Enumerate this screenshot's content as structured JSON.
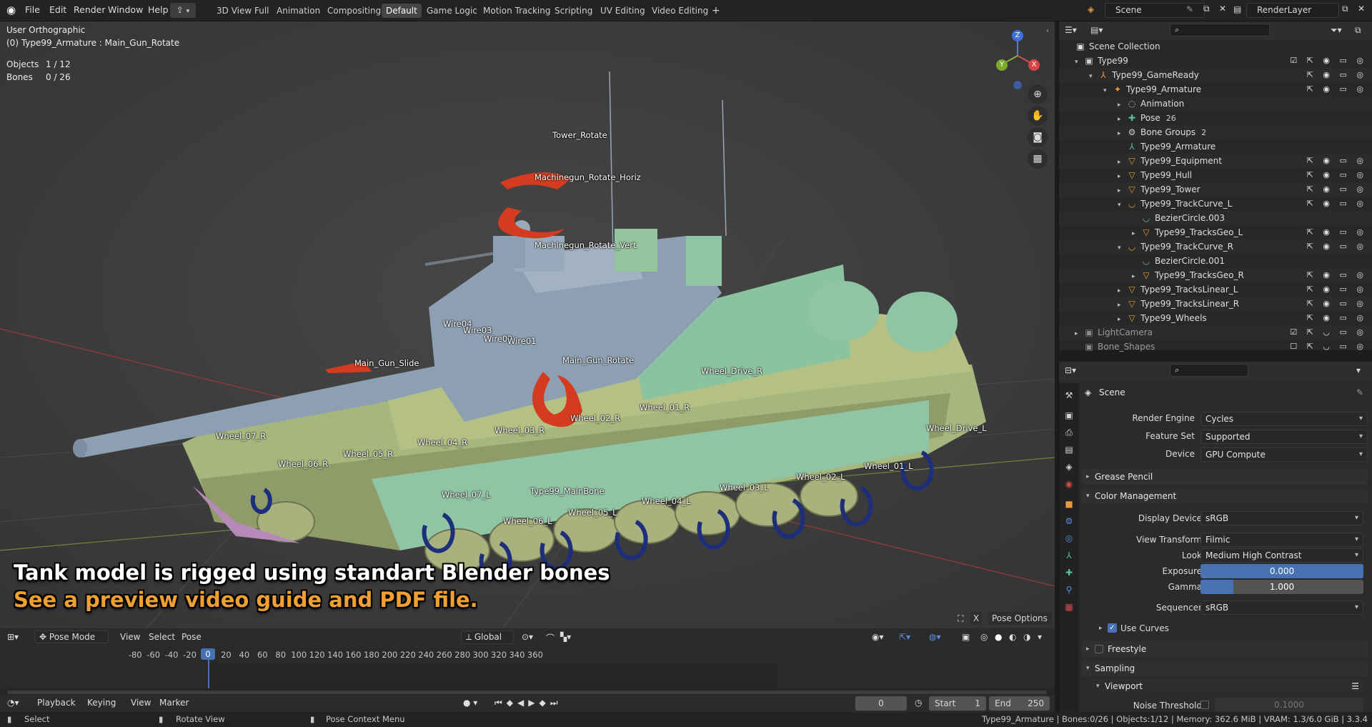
{
  "menubar": {
    "items": [
      "File",
      "Edit",
      "Render",
      "Window",
      "Help"
    ],
    "workspaces": [
      "3D View Full",
      "Animation",
      "Compositing",
      "Default",
      "Game Logic",
      "Motion Tracking",
      "Scripting",
      "UV Editing",
      "Video Editing"
    ],
    "active_workspace": "Default",
    "add_workspace": "+",
    "scene": "Scene",
    "render_layer": "RenderLayer"
  },
  "viewport": {
    "view_name": "User Orthographic",
    "active_object": "(0) Type99_Armature : Main_Gun_Rotate",
    "objects_label": "Objects",
    "objects_value": "1 / 12",
    "bones_label": "Bones",
    "bones_value": "0 / 26",
    "gizmo_axes": {
      "x": "X",
      "y": "Y",
      "z": "Z"
    },
    "bone_labels": [
      "Tower_Rotate",
      "Machinegun_Rotate_Horiz",
      "Machinegun_Rotate_Vert",
      "Wire04",
      "Wire03",
      "Wire02",
      "Wire01",
      "Main_Gun_Slide",
      "Main_Gun_Rotate",
      "Wheel_Drive_R",
      "Wheel_01_R",
      "Wheel_02_R",
      "Wheel_03_R",
      "Wheel_04_R",
      "Wheel_05_R",
      "Wheel_06_R",
      "Wheel_07_R",
      "Wheel_Drive_L",
      "Wheel_01_L",
      "Wheel_02_L",
      "Wheel_03_L",
      "Wheel_04_L",
      "Wheel_05_L",
      "Wheel_06_L",
      "Wheel_07_L",
      "Type99_MainBone"
    ],
    "overlay_line1": "Tank model is rigged using standart Blender bones",
    "overlay_line2": "See a preview video guide and PDF file.",
    "overlay_color1": "#ffffff",
    "overlay_color2": "#f0a030",
    "pose_options": "Pose Options",
    "x_mirror": "X"
  },
  "viewport_header": {
    "mode": "Pose Mode",
    "menus": [
      "View",
      "Select",
      "Pose"
    ],
    "orientation": "Global"
  },
  "timeline": {
    "ticks": [
      -80,
      -60,
      -40,
      -20,
      0,
      20,
      40,
      60,
      80,
      100,
      120,
      140,
      160,
      180,
      200,
      220,
      240,
      260,
      280,
      300,
      320,
      340,
      360
    ],
    "current_frame": "0",
    "menus": [
      "Playback",
      "Keying",
      "View",
      "Marker"
    ],
    "frame_field": "0",
    "start_label": "Start",
    "start_value": "1",
    "end_label": "End",
    "end_value": "250"
  },
  "statusbar": {
    "select": "Select",
    "rotate": "Rotate View",
    "context": "Pose Context Menu",
    "info": "Type99_Armature | Bones:0/26 | Objects:1/12 | Memory: 362.6 MiB | VRAM: 1.3/6.0 GiB | 3.3.4"
  },
  "outliner": {
    "root": "Scene Collection",
    "rows": [
      {
        "name": "Type99",
        "depth": 0,
        "tri": "▾",
        "icon": "▣",
        "color": "#cfcfcf",
        "right": "☑ ⇱ ◉ ▭ ◎"
      },
      {
        "name": "Type99_GameReady",
        "depth": 1,
        "tri": "▾",
        "icon": "⅄",
        "color": "#e49a3d",
        "right": "⇱ ◉ ▭ ◎"
      },
      {
        "name": "Type99_Armature",
        "depth": 2,
        "tri": "▾",
        "icon": "✦",
        "color": "#e49a3d",
        "right": "⇱ ◉ ▭ ◎"
      },
      {
        "name": "Animation",
        "depth": 3,
        "tri": "▸",
        "icon": "◌",
        "color": "#cfcfcf",
        "right": ""
      },
      {
        "name": "Pose",
        "depth": 3,
        "tri": "▸",
        "icon": "✚",
        "color": "#55c29a",
        "extra": "26",
        "right": ""
      },
      {
        "name": "Bone Groups",
        "depth": 3,
        "tri": "▸",
        "icon": "⚙",
        "color": "#cfcfcf",
        "extra": "2",
        "right": ""
      },
      {
        "name": "Type99_Armature",
        "depth": 3,
        "tri": "",
        "icon": "⅄",
        "color": "#55c29a",
        "right": ""
      },
      {
        "name": "Type99_Equipment",
        "depth": 3,
        "tri": "▸",
        "icon": "▽",
        "color": "#e49a3d",
        "right": "⇱ ◉ ▭ ◎"
      },
      {
        "name": "Type99_Hull",
        "depth": 3,
        "tri": "▸",
        "icon": "▽",
        "color": "#e49a3d",
        "right": "⇱ ◉ ▭ ◎"
      },
      {
        "name": "Type99_Tower",
        "depth": 3,
        "tri": "▸",
        "icon": "▽",
        "color": "#e49a3d",
        "right": "⇱ ◉ ▭ ◎"
      },
      {
        "name": "Type99_TrackCurve_L",
        "depth": 3,
        "tri": "▾",
        "icon": "◡",
        "color": "#e49a3d",
        "right": "⇱ ◉ ▭ ◎"
      },
      {
        "name": "BezierCircle.003",
        "depth": 4,
        "tri": "",
        "icon": "◡",
        "color": "#55c29a",
        "right": ""
      },
      {
        "name": "Type99_TracksGeo_L",
        "depth": 4,
        "tri": "▸",
        "icon": "▽",
        "color": "#e49a3d",
        "right": "⇱ ◉ ▭ ◎"
      },
      {
        "name": "Type99_TrackCurve_R",
        "depth": 3,
        "tri": "▾",
        "icon": "◡",
        "color": "#e49a3d",
        "right": "⇱ ◉ ▭ ◎"
      },
      {
        "name": "BezierCircle.001",
        "depth": 4,
        "tri": "",
        "icon": "◡",
        "color": "#55c29a",
        "right": ""
      },
      {
        "name": "Type99_TracksGeo_R",
        "depth": 4,
        "tri": "▸",
        "icon": "▽",
        "color": "#e49a3d",
        "right": "⇱ ◉ ▭ ◎"
      },
      {
        "name": "Type99_TracksLinear_L",
        "depth": 3,
        "tri": "▸",
        "icon": "▽",
        "color": "#e49a3d",
        "right": "⇱ ◉ ▭ ◎"
      },
      {
        "name": "Type99_TracksLinear_R",
        "depth": 3,
        "tri": "▸",
        "icon": "▽",
        "color": "#e49a3d",
        "right": "⇱ ◉ ▭ ◎"
      },
      {
        "name": "Type99_Wheels",
        "depth": 3,
        "tri": "▸",
        "icon": "▽",
        "color": "#e49a3d",
        "right": "⇱ ◉ ▭ ◎"
      },
      {
        "name": "LightCamera",
        "depth": 0,
        "tri": "▸",
        "icon": "▣",
        "color": "#8a8a8a",
        "right": "☑ ⇱ ◡ ▭ ◎"
      },
      {
        "name": "Bone_Shapes",
        "depth": 0,
        "tri": "",
        "icon": "▣",
        "color": "#8a8a8a",
        "right": "☐ ⇱ ◡ ▭ ◎"
      }
    ]
  },
  "properties": {
    "context": "Scene",
    "render_engine_label": "Render Engine",
    "render_engine": "Cycles",
    "feature_set_label": "Feature Set",
    "feature_set": "Supported",
    "device_label": "Device",
    "device": "GPU Compute",
    "grease_pencil": "Grease Pencil",
    "color_management": "Color Management",
    "display_device_label": "Display Device",
    "display_device": "sRGB",
    "view_transform_label": "View Transform",
    "view_transform": "Filmic",
    "look_label": "Look",
    "look": "Medium High Contrast",
    "exposure_label": "Exposure",
    "exposure": "0.000",
    "gamma_label": "Gamma",
    "gamma": "1.000",
    "gamma_fill": 0.2,
    "sequencer_label": "Sequencer",
    "sequencer": "sRGB",
    "use_curves": "Use Curves",
    "freestyle": "Freestyle",
    "sampling": "Sampling",
    "viewport_panel": "Viewport",
    "noise_threshold_label": "Noise Threshold",
    "noise_threshold": "0.1000"
  }
}
